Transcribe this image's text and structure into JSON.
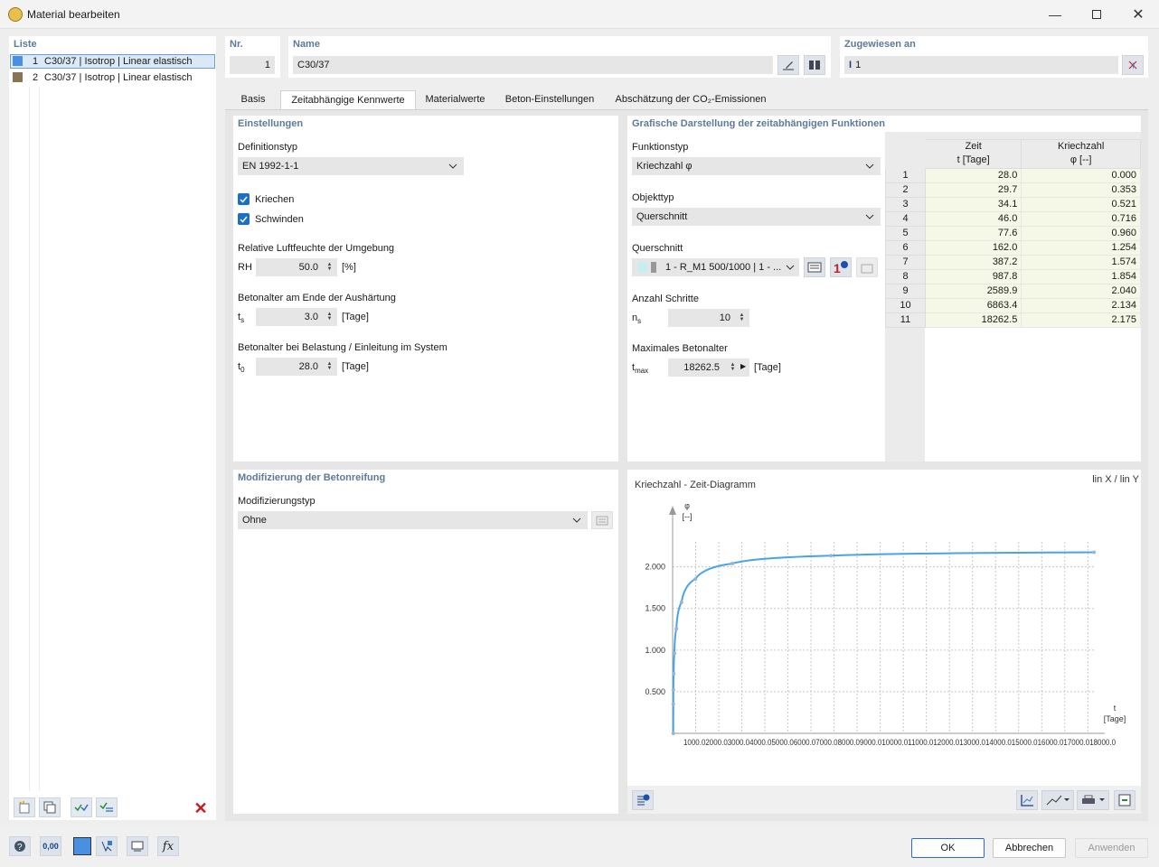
{
  "window": {
    "title": "Material bearbeiten"
  },
  "liste": {
    "title": "Liste",
    "items": [
      {
        "nr": "1",
        "label": "C30/37 | Isotrop | Linear elastisch",
        "color": "#4a90e2"
      },
      {
        "nr": "2",
        "label": "C30/37 | Isotrop | Linear elastisch",
        "color": "#8b7355"
      }
    ]
  },
  "header": {
    "nr_label": "Nr.",
    "nr_value": "1",
    "name_label": "Name",
    "name_value": "C30/37",
    "assigned_label": "Zugewiesen an",
    "assigned_value": "1"
  },
  "tabs": [
    "Basis",
    "Zeitabhängige Kennwerte",
    "Materialwerte",
    "Beton-Einstellungen",
    "Abschätzung der CO₂-Emissionen"
  ],
  "active_tab": 1,
  "einstellungen": {
    "title": "Einstellungen",
    "definitionstyp_label": "Definitionstyp",
    "definitionstyp_value": "EN 1992-1-1",
    "kriechen": "Kriechen",
    "schwinden": "Schwinden",
    "rh_title": "Relative Luftfeuchte der Umgebung",
    "rh_symbol": "RH",
    "rh_value": "50.0",
    "rh_unit": "[%]",
    "ts_title": "Betonalter am Ende der Aushärtung",
    "ts_symbol": "t",
    "ts_sub": "s",
    "ts_value": "3.0",
    "ts_unit": "[Tage]",
    "t0_title": "Betonalter bei Belastung / Einleitung im System",
    "t0_symbol": "t",
    "t0_sub": "0",
    "t0_value": "28.0",
    "t0_unit": "[Tage]"
  },
  "modifizierung": {
    "title": "Modifizierung der Betonreifung",
    "typ_label": "Modifizierungstyp",
    "typ_value": "Ohne"
  },
  "grafik": {
    "title": "Grafische Darstellung der zeitabhängigen Funktionen",
    "funktionstyp_label": "Funktionstyp",
    "funktionstyp_value": "Kriechzahl φ",
    "objekttyp_label": "Objekttyp",
    "objekttyp_value": "Querschnitt",
    "querschnitt_label": "Querschnitt",
    "querschnitt_value": "1 - R_M1 500/1000 | 1 - ...",
    "schritte_label": "Anzahl Schritte",
    "schritte_symbol": "n",
    "schritte_sub": "s",
    "schritte_value": "10",
    "max_label": "Maximales Betonalter",
    "max_symbol": "t",
    "max_sub": "max",
    "max_value": "18262.5",
    "max_unit": "[Tage]"
  },
  "table": {
    "col1": "Zeit",
    "col1_unit": "t [Tage]",
    "col2": "Kriechzahl",
    "col2_unit": "φ [--]",
    "rows": [
      [
        "1",
        "28.0",
        "0.000"
      ],
      [
        "2",
        "29.7",
        "0.353"
      ],
      [
        "3",
        "34.1",
        "0.521"
      ],
      [
        "4",
        "46.0",
        "0.716"
      ],
      [
        "5",
        "77.6",
        "0.960"
      ],
      [
        "6",
        "162.0",
        "1.254"
      ],
      [
        "7",
        "387.2",
        "1.574"
      ],
      [
        "8",
        "987.8",
        "1.854"
      ],
      [
        "9",
        "2589.9",
        "2.040"
      ],
      [
        "10",
        "6863.4",
        "2.134"
      ],
      [
        "11",
        "18262.5",
        "2.175"
      ]
    ]
  },
  "diagram": {
    "title": "Kriechzahl - Zeit-Diagramm",
    "scale": "lin X / lin Y",
    "y_label": "φ",
    "y_unit": "[--]",
    "x_label": "t",
    "x_unit": "[Tage]",
    "y_ticks": [
      "0.500",
      "1.000",
      "1.500",
      "2.000"
    ],
    "x_ticks": "1000.02000.03000.04000.05000.06000.07000.08000.09000.010000.011000.012000.013000.014000.015000.016000.017000.018000.0"
  },
  "chart_data": {
    "type": "line",
    "title": "Kriechzahl - Zeit-Diagramm",
    "xlabel": "t [Tage]",
    "ylabel": "φ [--]",
    "xlim": [
      0,
      18262.5
    ],
    "ylim": [
      0,
      2.3
    ],
    "series": [
      {
        "x": [
          28.0,
          29.7,
          34.1,
          46.0,
          77.6,
          162.0,
          387.2,
          987.8,
          2589.9,
          6863.4,
          18262.5
        ],
        "values": [
          0.0,
          0.353,
          0.521,
          0.716,
          0.96,
          1.254,
          1.574,
          1.854,
          2.04,
          2.134,
          2.175
        ]
      }
    ],
    "color": "#4aa3e8"
  },
  "footer": {
    "ok": "OK",
    "cancel": "Abbrechen",
    "apply": "Anwenden",
    "zero_val": "0,00"
  }
}
